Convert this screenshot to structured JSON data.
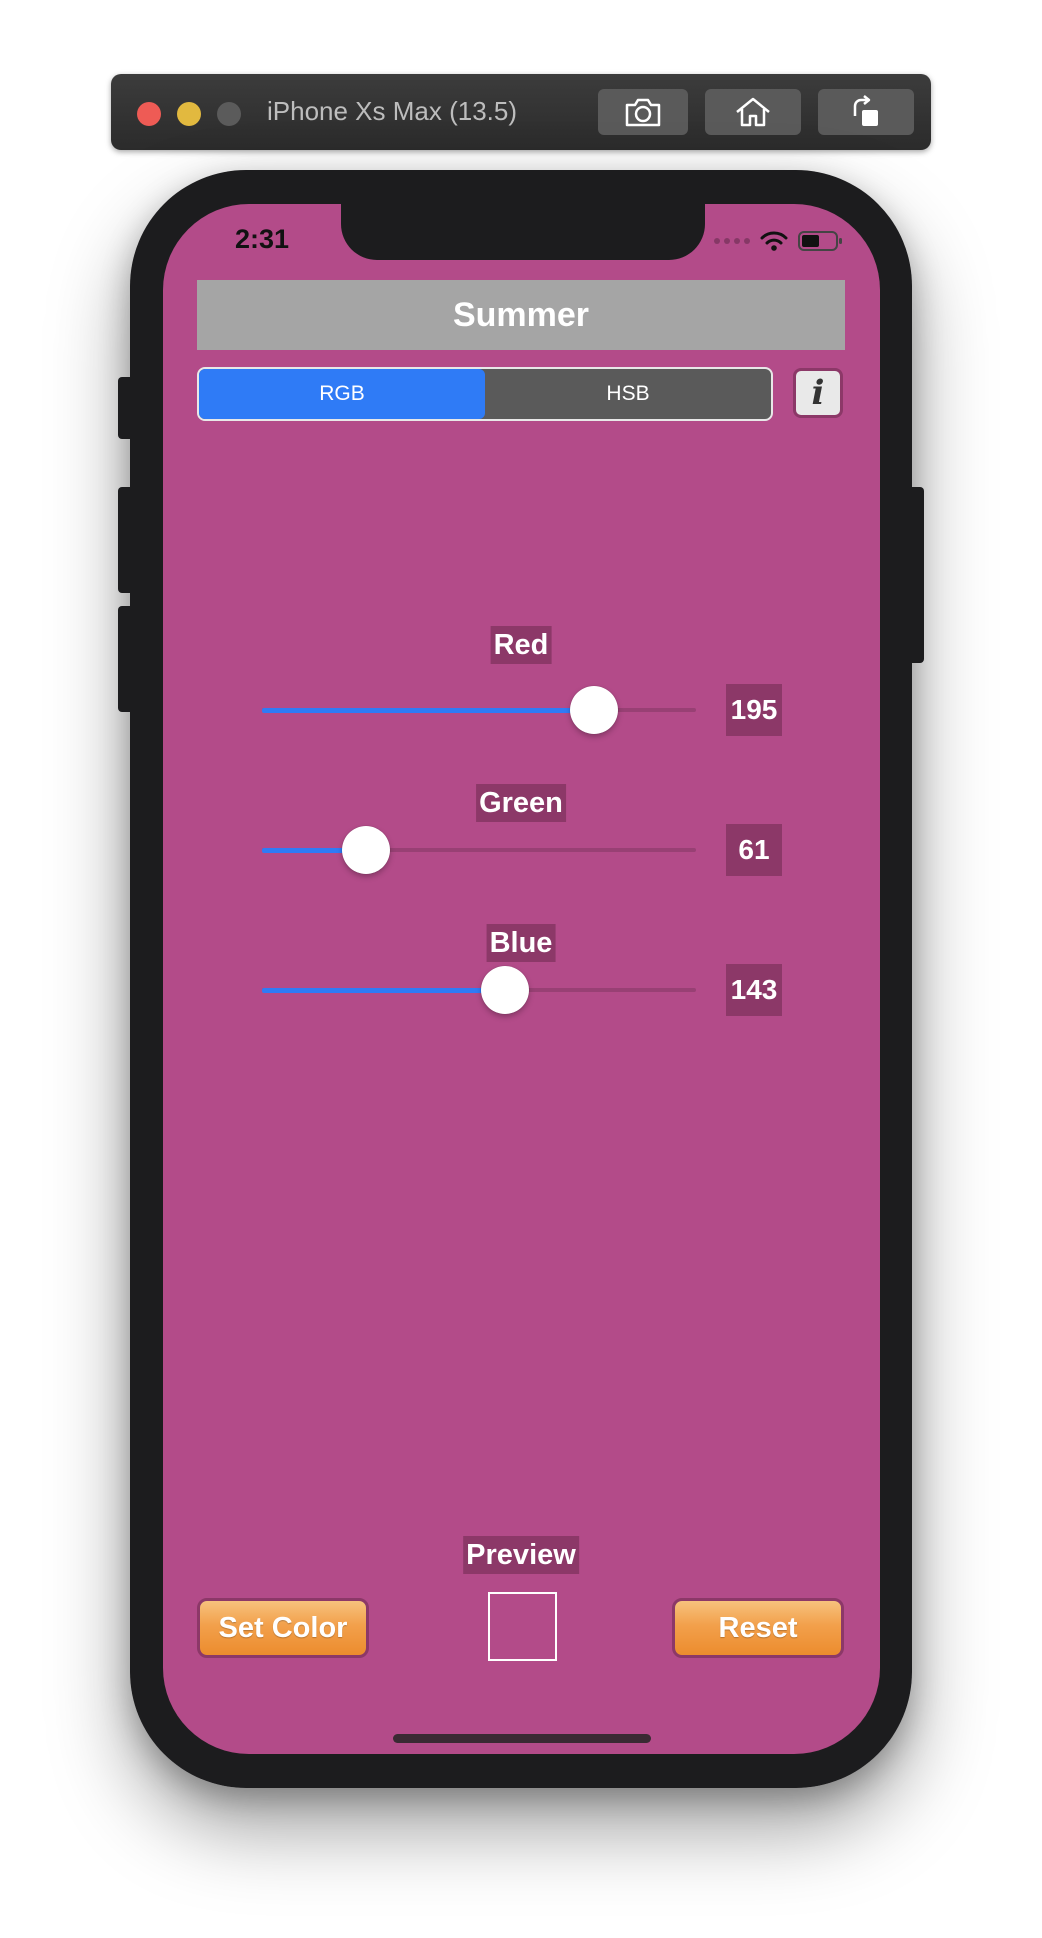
{
  "simulator": {
    "title": "iPhone Xs Max (13.5)",
    "buttons": [
      "screenshot-icon",
      "home-icon",
      "rotate-icon"
    ]
  },
  "status_bar": {
    "time": "2:31"
  },
  "app": {
    "title": "Summer",
    "background_color": "#b34b89",
    "segments": [
      "RGB",
      "HSB"
    ],
    "selected_segment": "RGB",
    "info_label": "i",
    "sliders": [
      {
        "label": "Red",
        "value": "195",
        "fraction": 0.765
      },
      {
        "label": "Green",
        "value": "61",
        "fraction": 0.239
      },
      {
        "label": "Blue",
        "value": "143",
        "fraction": 0.561
      }
    ],
    "preview_label": "Preview",
    "set_color_label": "Set Color",
    "reset_label": "Reset"
  },
  "colors": {
    "accent": "#2f7bf6",
    "label_bg": "#8c3868",
    "title_bg": "#a5a5a5"
  }
}
